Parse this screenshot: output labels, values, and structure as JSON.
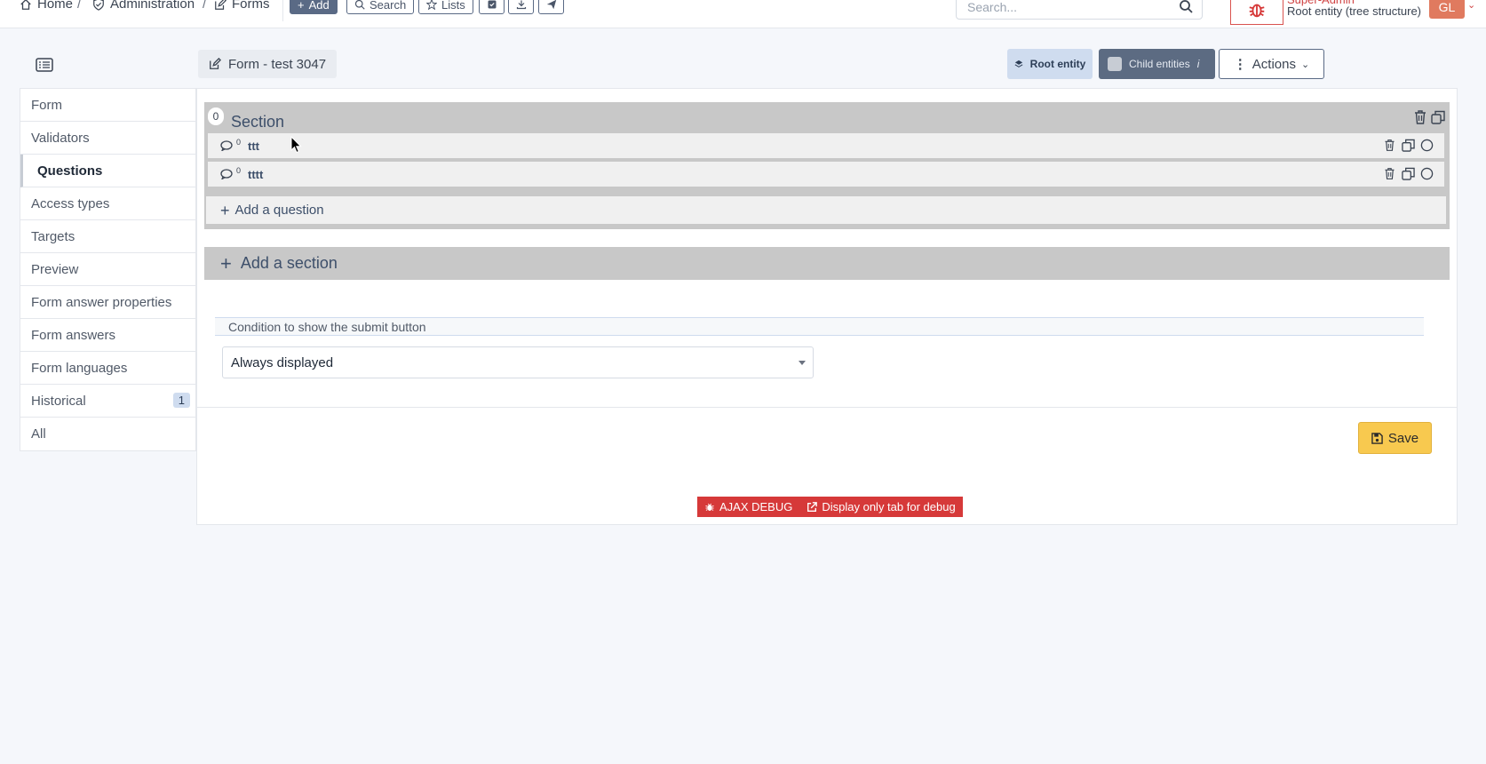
{
  "breadcrumb": {
    "home": "Home",
    "sep1": "/",
    "admin": "Administration",
    "sep2": "/",
    "forms": "Forms"
  },
  "toolbar": {
    "add": "Add",
    "search": "Search",
    "lists": "Lists"
  },
  "global_search": {
    "placeholder": "Search..."
  },
  "user": {
    "role": "Super-Admin",
    "entity": "Root entity (tree structure)",
    "initials": "GL"
  },
  "header": {
    "form_title": "Form - test 3047",
    "root_entity": "Root entity",
    "child_entities": "Child entities",
    "child_info": "i",
    "actions": "Actions"
  },
  "sidebar": {
    "items": [
      {
        "label": "Form"
      },
      {
        "label": "Validators"
      },
      {
        "label": "Questions",
        "active": true
      },
      {
        "label": "Access types"
      },
      {
        "label": "Targets"
      },
      {
        "label": "Preview"
      },
      {
        "label": "Form answer properties"
      },
      {
        "label": "Form answers"
      },
      {
        "label": "Form languages"
      },
      {
        "label": "Historical",
        "badge": "1"
      },
      {
        "label": "All"
      }
    ]
  },
  "section": {
    "badge": "0",
    "title": "Section",
    "questions": [
      {
        "badge": "0",
        "label": "ttt"
      },
      {
        "badge": "0",
        "label": "tttt"
      }
    ],
    "add_question": "Add a question"
  },
  "add_section": "Add a section",
  "submit_condition": {
    "label": "Condition to show the submit button",
    "value": "Always displayed"
  },
  "save": "Save",
  "debug": {
    "ajax": "AJAX DEBUG",
    "tab": "Display only tab for debug"
  },
  "colors": {
    "primary": "#5a6a85",
    "section_bg": "#c8c8c8",
    "save": "#f8c94f",
    "debug": "#d63939",
    "root_entity_bg": "#cfdcef"
  }
}
